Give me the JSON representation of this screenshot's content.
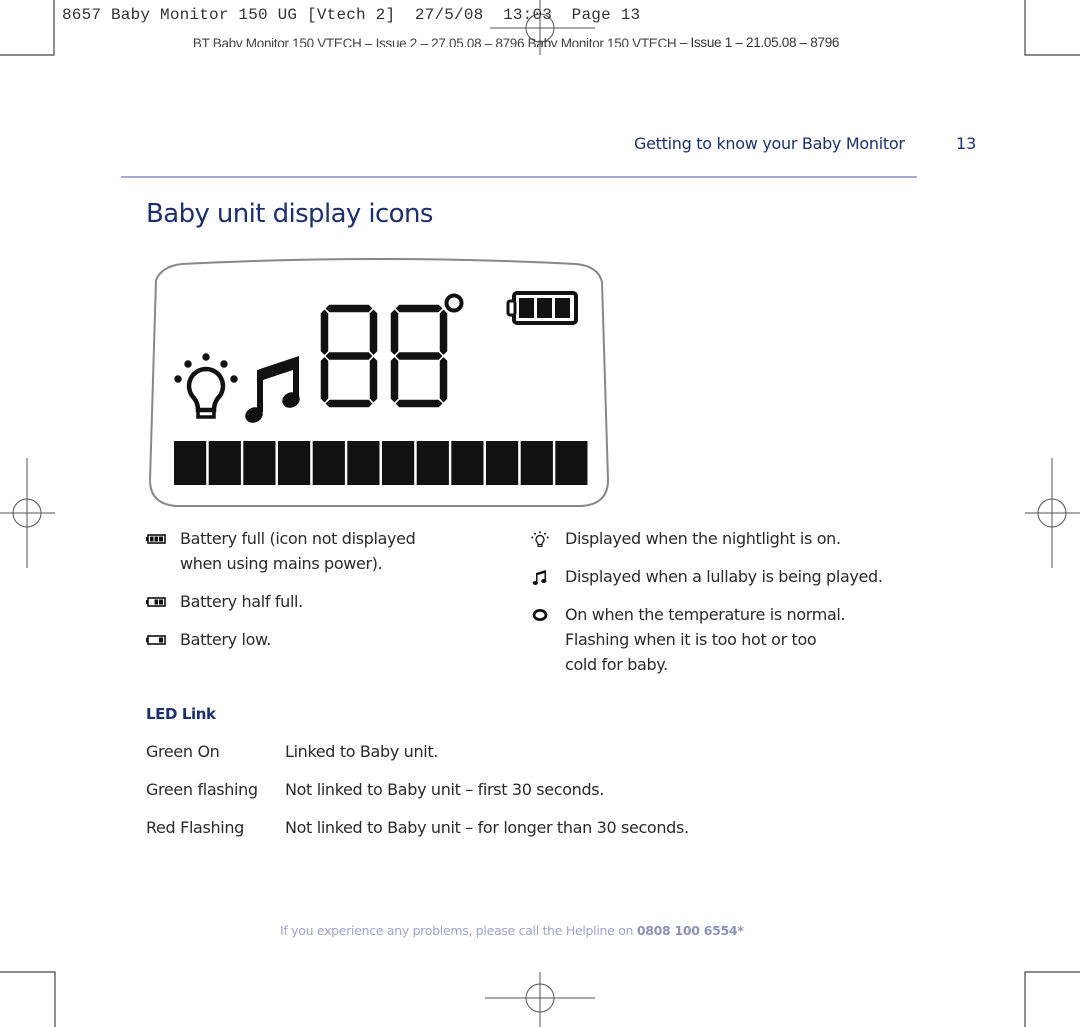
{
  "print_slug": {
    "job_line": "8657 Baby Monitor 150 UG [Vtech 2]  27/5/08  13:03  Page 13",
    "issue_line_overlap": "BT Baby Monitor 150 VTECH – Issue 2 – 27.05.08 – 8796 Baby Monitor 150 VTECH",
    "issue_line_visible": " – Issue 1 – 21.05.08 – 8796"
  },
  "header": {
    "section_title": "Getting to know your Baby Monitor",
    "page_number": "13"
  },
  "page_title": "Baby unit display icons",
  "lcd_display": {
    "temperature_digits": "88",
    "degree_symbol": "°",
    "battery_bars": 3,
    "level_segments": 12,
    "icons": [
      "nightlight-icon",
      "music-note-icon",
      "degree-icon",
      "battery-icon"
    ]
  },
  "icon_legend": {
    "left": [
      {
        "icon": "battery-full-icon",
        "lines": [
          "Battery full  (icon not displayed",
          "when using mains power)."
        ]
      },
      {
        "icon": "battery-half-icon",
        "lines": [
          "Battery half full."
        ]
      },
      {
        "icon": "battery-low-icon",
        "lines": [
          "Battery low."
        ]
      }
    ],
    "right": [
      {
        "icon": "nightlight-icon",
        "lines": [
          "Displayed when the nightlight is on."
        ]
      },
      {
        "icon": "music-note-icon",
        "lines": [
          "Displayed when a lullaby is being played."
        ]
      },
      {
        "icon": "temperature-ring-icon",
        "lines": [
          "On when the temperature is normal.",
          "Flashing when it is too hot or too",
          "cold for baby."
        ]
      }
    ]
  },
  "led_link": {
    "heading": "LED Link",
    "rows": [
      {
        "state": "Green On",
        "meaning": "Linked to Baby unit."
      },
      {
        "state": "Green flashing",
        "meaning": "Not linked to Baby unit – first 30 seconds."
      },
      {
        "state": "Red Flashing",
        "meaning": "Not linked to Baby unit – for longer than 30 seconds."
      }
    ]
  },
  "footer": {
    "text": "If you experience any problems, please call the Helpline on ",
    "phone": "0808 100 6554*"
  },
  "colors": {
    "brand_blue": "#1d2f6f",
    "rule": "#a5abd6",
    "footer_text": "#9ea4c8",
    "lcd_ink": "#111111"
  }
}
